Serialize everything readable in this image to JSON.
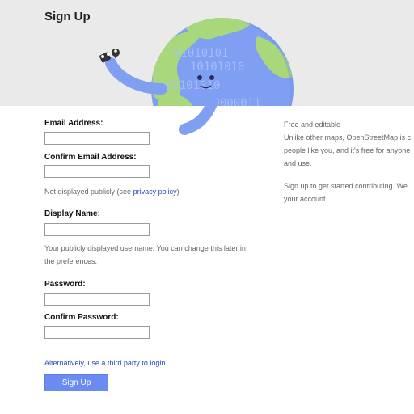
{
  "page": {
    "title": "Sign Up"
  },
  "form": {
    "email_label": "Email Address:",
    "email_value": "",
    "confirm_email_label": "Confirm Email Address:",
    "confirm_email_value": "",
    "email_hint_prefix": "Not displayed publicly (see ",
    "privacy_link": "privacy policy",
    "email_hint_suffix": ")",
    "display_name_label": "Display Name:",
    "display_name_value": "",
    "display_name_hint_line1": "Your publicly displayed username. You can change this later in",
    "display_name_hint_line2": "the preferences.",
    "password_label": "Password:",
    "password_value": "",
    "confirm_password_label": "Confirm Password:",
    "confirm_password_value": "",
    "third_party_link": "Alternatively, use a third party to login",
    "submit_label": "Sign Up"
  },
  "sidebar": {
    "heading": "Free and editable",
    "line1": "Unlike other maps, OpenStreetMap is c",
    "line2": "people like you, and it's free for anyone",
    "line3": "and use.",
    "line4": "Sign up to get started contributing. We'",
    "line5": "your account."
  },
  "illustration": {
    "globe_digits": [
      "01010101",
      "10101010",
      "01101010",
      "10000011"
    ]
  },
  "colors": {
    "banner": "#eaeaea",
    "globe_water": "#7f9ff2",
    "globe_land": "#a9d87c",
    "link": "#2747c7",
    "button": "#6a8cf0"
  }
}
